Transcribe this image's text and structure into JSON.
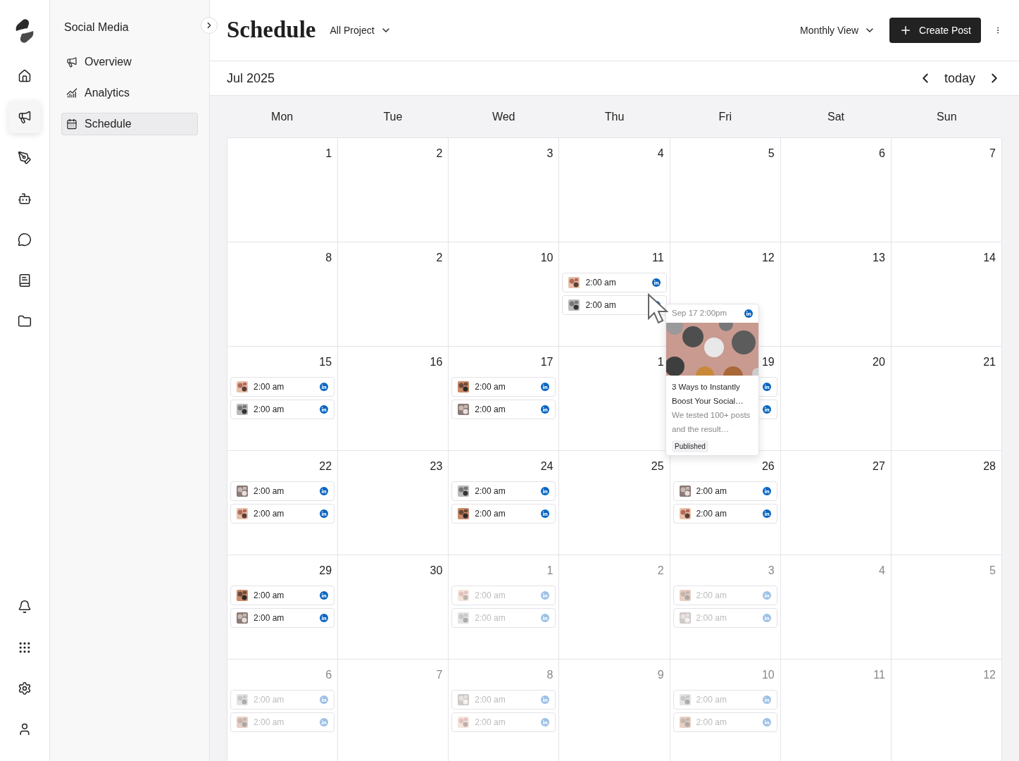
{
  "rail": {
    "items": [
      {
        "selected": false
      },
      {
        "selected": true
      },
      {
        "selected": false
      },
      {
        "selected": false
      },
      {
        "selected": false
      },
      {
        "selected": false
      },
      {
        "selected": false
      }
    ]
  },
  "sidebar": {
    "title": "Social Media",
    "items": [
      {
        "label": "Overview",
        "selected": false
      },
      {
        "label": "Analytics",
        "selected": false
      },
      {
        "label": "Schedule",
        "selected": true
      }
    ]
  },
  "header": {
    "title": "Schedule",
    "project_filter": "All Project",
    "view": "Monthly View",
    "create_button": "Create Post"
  },
  "calendar": {
    "month": "Jul 2025",
    "today_button": "today",
    "weekdays": [
      "Mon",
      "Tue",
      "Wed",
      "Thu",
      "Fri",
      "Sat",
      "Sun"
    ],
    "weeks": [
      [
        {
          "day": "1",
          "muted": false
        },
        {
          "day": "2",
          "muted": false
        },
        {
          "day": "3",
          "muted": false
        },
        {
          "day": "4",
          "muted": false
        },
        {
          "day": "5",
          "muted": false
        },
        {
          "day": "6",
          "muted": false
        },
        {
          "day": "7",
          "muted": false
        }
      ],
      [
        {
          "day": "8",
          "muted": false
        },
        {
          "day": "2",
          "muted": false
        },
        {
          "day": "10",
          "muted": false
        },
        {
          "day": "11",
          "muted": false,
          "posts": [
            {
              "time": "2:00 am"
            },
            {
              "time": "2:00 am"
            }
          ]
        },
        {
          "day": "12",
          "muted": false
        },
        {
          "day": "13",
          "muted": false
        },
        {
          "day": "14",
          "muted": false
        }
      ],
      [
        {
          "day": "15",
          "muted": false,
          "posts": [
            {
              "time": "2:00 am"
            },
            {
              "time": "2:00 am"
            }
          ]
        },
        {
          "day": "16",
          "muted": false
        },
        {
          "day": "17",
          "muted": false,
          "posts": [
            {
              "time": "2:00 am"
            },
            {
              "time": "2:00 am"
            }
          ]
        },
        {
          "day": "1",
          "muted": false
        },
        {
          "day": "19",
          "muted": false,
          "posts": [
            {
              "kind": "covered"
            },
            {
              "kind": "covered"
            }
          ]
        },
        {
          "day": "20",
          "muted": false
        },
        {
          "day": "21",
          "muted": false
        }
      ],
      [
        {
          "day": "22",
          "muted": false,
          "posts": [
            {
              "time": "2:00 am"
            },
            {
              "time": "2:00 am"
            }
          ]
        },
        {
          "day": "23",
          "muted": false
        },
        {
          "day": "24",
          "muted": false,
          "posts": [
            {
              "time": "2:00 am"
            },
            {
              "time": "2:00 am"
            }
          ]
        },
        {
          "day": "25",
          "muted": false
        },
        {
          "day": "26",
          "muted": false,
          "posts": [
            {
              "time": "2:00 am"
            },
            {
              "time": "2:00 am"
            }
          ]
        },
        {
          "day": "27",
          "muted": false
        },
        {
          "day": "28",
          "muted": false
        }
      ],
      [
        {
          "day": "29",
          "muted": false,
          "posts": [
            {
              "time": "2:00 am"
            },
            {
              "time": "2:00 am"
            }
          ]
        },
        {
          "day": "30",
          "muted": false
        },
        {
          "day": "1",
          "muted": true,
          "posts": [
            {
              "time": "2:00 am"
            },
            {
              "time": "2:00 am"
            }
          ]
        },
        {
          "day": "2",
          "muted": true
        },
        {
          "day": "3",
          "muted": true,
          "posts": [
            {
              "time": "2:00 am"
            },
            {
              "time": "2:00 am"
            }
          ]
        },
        {
          "day": "4",
          "muted": true
        },
        {
          "day": "5",
          "muted": true
        }
      ],
      [
        {
          "day": "6",
          "muted": true,
          "posts": [
            {
              "time": "2:00 am"
            },
            {
              "time": "2:00 am"
            }
          ]
        },
        {
          "day": "7",
          "muted": true
        },
        {
          "day": "8",
          "muted": true,
          "posts": [
            {
              "time": "2:00 am"
            },
            {
              "time": "2:00 am"
            }
          ]
        },
        {
          "day": "9",
          "muted": true
        },
        {
          "day": "10",
          "muted": true,
          "posts": [
            {
              "time": "2:00 am"
            },
            {
              "time": "2:00 am"
            }
          ]
        },
        {
          "day": "11",
          "muted": true
        },
        {
          "day": "12",
          "muted": true
        }
      ]
    ]
  },
  "popover": {
    "date": "Sep 17 2:00pm",
    "title": "3 Ways to Instantly Boost Your Social…",
    "excerpt": "We tested 100+ posts and the result…",
    "status": "Published"
  }
}
